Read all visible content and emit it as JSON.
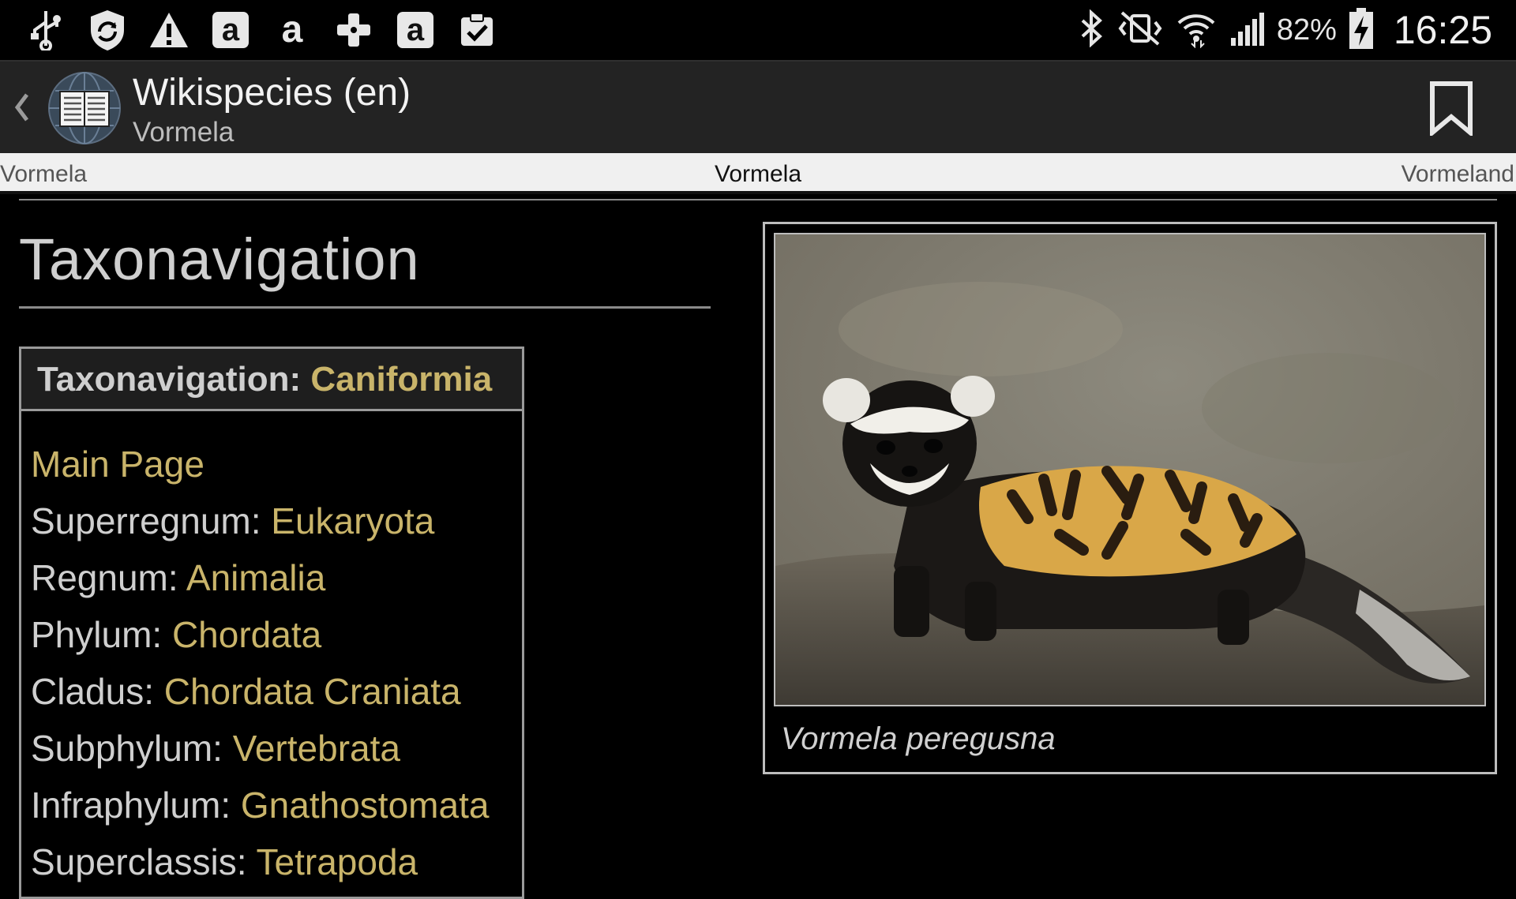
{
  "status_bar": {
    "left_icons": [
      "usb-icon",
      "shield-sync-icon",
      "warning-icon",
      "amazon-icon",
      "amazon-icon",
      "game-controller-icon",
      "amazon-icon",
      "clipboard-check-icon"
    ],
    "right_icons": [
      "bluetooth-icon",
      "vibrate-mute-icon",
      "wifi-icon",
      "signal-icon",
      "battery-charging-icon"
    ],
    "battery": "82%",
    "time": "16:25"
  },
  "action_bar": {
    "title": "Wikispecies (en)",
    "subtitle": "Vormela",
    "bookmark_icon": "bookmark-icon"
  },
  "tabs": {
    "left": "Vormela",
    "center": "Vormela",
    "right": "Vormeland"
  },
  "page": {
    "heading": "Taxonavigation",
    "navbox": {
      "header_label": "Taxonavigation:",
      "header_link": "Caniformia",
      "rows": [
        {
          "rank": "",
          "name": "Main Page"
        },
        {
          "rank": "Superregnum:",
          "name": "Eukaryota"
        },
        {
          "rank": "Regnum:",
          "name": "Animalia"
        },
        {
          "rank": "Phylum:",
          "name": "Chordata"
        },
        {
          "rank": "Cladus:",
          "name": "Chordata Craniata"
        },
        {
          "rank": "Subphylum:",
          "name": "Vertebrata"
        },
        {
          "rank": "Infraphylum:",
          "name": "Gnathostomata"
        },
        {
          "rank": "Superclassis:",
          "name": "Tetrapoda"
        }
      ]
    },
    "image_caption": "Vormela peregusna"
  },
  "colors": {
    "link": "#c9b46a",
    "background": "#000000",
    "action_bar": "#232323",
    "tab_strip": "#f0f0f0"
  }
}
